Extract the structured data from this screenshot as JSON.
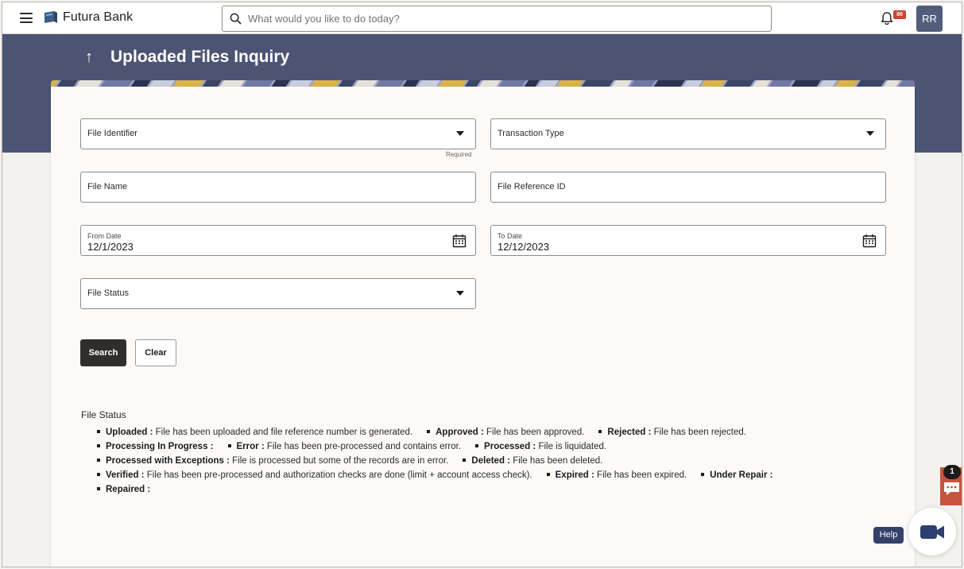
{
  "app": {
    "brand": "Futura Bank"
  },
  "topbar": {
    "search_placeholder": "What would you like to do today?",
    "notifications_count": "80",
    "avatar_initials": "RR"
  },
  "page": {
    "title": "Uploaded Files Inquiry",
    "back_arrow": "↑"
  },
  "form": {
    "file_identifier_label": "File Identifier",
    "required_note": "Required",
    "transaction_type_label": "Transaction Type",
    "file_name_label": "File Name",
    "file_reference_label": "File Reference ID",
    "from_date_label": "From Date",
    "from_date_value": "12/1/2023",
    "to_date_label": "To Date",
    "to_date_value": "12/12/2023",
    "file_status_label": "File Status",
    "search_label": "Search",
    "clear_label": "Clear"
  },
  "legend": {
    "title": "File Status",
    "rows": [
      [
        {
          "term": "Uploaded :",
          "desc": "File has been uploaded and file reference number is generated."
        },
        {
          "term": "Approved :",
          "desc": "File has been approved."
        },
        {
          "term": "Rejected :",
          "desc": "File has been rejected."
        }
      ],
      [
        {
          "term": "Processing In Progress :",
          "desc": ""
        },
        {
          "term": "Error :",
          "desc": "File has been pre-processed and contains error."
        },
        {
          "term": "Processed :",
          "desc": "File is liquidated."
        }
      ],
      [
        {
          "term": "Processed with Exceptions :",
          "desc": "File is processed but some of the records are in error."
        },
        {
          "term": "Deleted :",
          "desc": "File has been deleted."
        }
      ],
      [
        {
          "term": "Verified :",
          "desc": "File has been pre-processed and authorization checks are done (limit + account access check)."
        },
        {
          "term": "Expired :",
          "desc": "File has been expired."
        },
        {
          "term": "Under Repair :",
          "desc": ""
        }
      ],
      [
        {
          "term": "Repaired :",
          "desc": ""
        }
      ]
    ]
  },
  "floating": {
    "chat_count": "1",
    "help_label": "Help"
  },
  "colors": {
    "header_band": "#4c5473",
    "primary_button": "#312d2a",
    "badge": "#c74634",
    "chat": "#c5543d",
    "help": "#34416b",
    "avatar": "#525c7b"
  }
}
